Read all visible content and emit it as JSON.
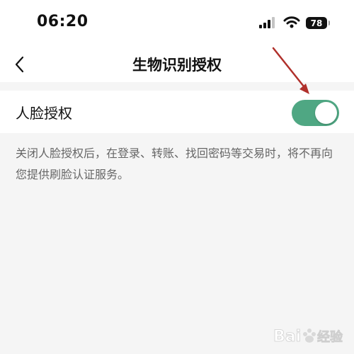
{
  "status_bar": {
    "time": "06:20",
    "battery_level": "78",
    "icons": [
      "cellular-signal-icon",
      "wifi-icon",
      "battery-icon"
    ]
  },
  "nav": {
    "title": "生物识别授权",
    "back_icon": "chevron-left-icon"
  },
  "settings": {
    "face_auth": {
      "label": "人脸授权",
      "enabled": true
    }
  },
  "description": "关闭人脸授权后，在登录、转账、找回密码等交易时，将不再向您提供刷脸认证服务。",
  "colors": {
    "toggle_on": "#4fa783",
    "annotation_arrow": "#b0302b",
    "page_bg": "#f5f5f5"
  }
}
